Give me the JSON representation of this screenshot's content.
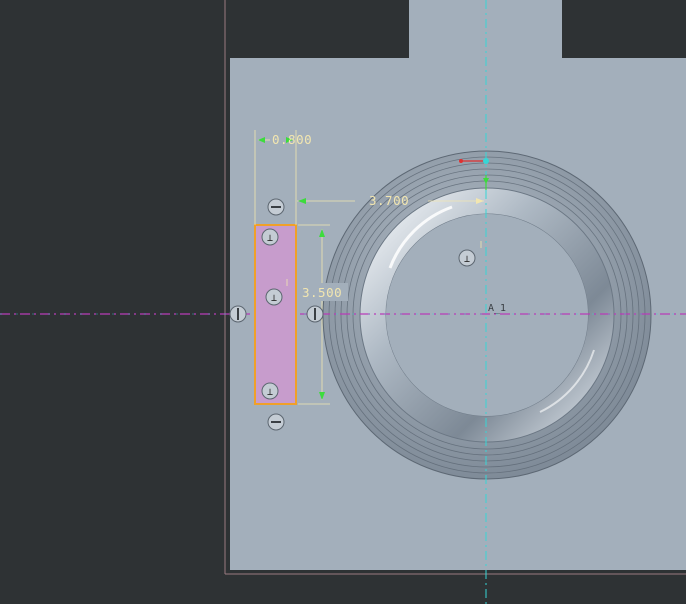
{
  "viewport": {
    "background": "#2e3234",
    "part_color": "#a3afbb",
    "frame_color": "#9a7a80",
    "centerline_vertical_color": "#37d6d6",
    "centerline_horizontal_color": "#b83cb8",
    "sketch_fill_color": "#c79ccc",
    "sketch_outline_color": "#f0a028",
    "dimension_color": "#f2e6b0",
    "arrow_color": "#3cdc3c"
  },
  "dimensions": {
    "top_width": "0.800",
    "offset": "3.700",
    "height": "3.500"
  },
  "constraint_icons": [
    {
      "name": "constraint-symbol-top",
      "glyph": "⊥"
    },
    {
      "name": "constraint-symbol-mid",
      "glyph": "⊥"
    },
    {
      "name": "constraint-symbol-bottom",
      "glyph": "⊥"
    },
    {
      "name": "constraint-symbol-ring",
      "glyph": "⊥"
    }
  ],
  "markers": {
    "center_label": "A_1"
  }
}
